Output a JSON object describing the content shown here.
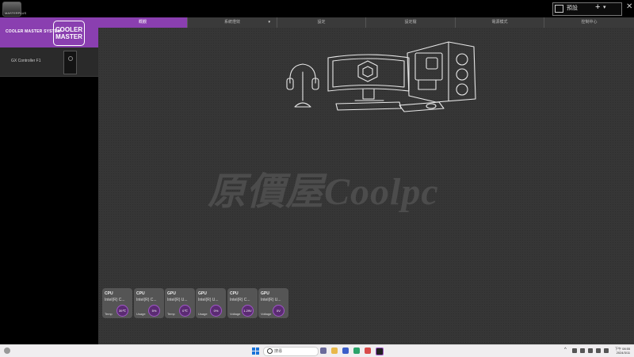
{
  "window": {
    "profile_label": "預設",
    "add_symbol": "+",
    "caret": "▾",
    "close_symbol": "✕",
    "app_logo_text": "MASTERPLUS"
  },
  "sidebar": {
    "brand_text": "COOLER MASTER SYSTEM",
    "brand_logo_line1": "COOLER",
    "brand_logo_line2": "MASTER",
    "brand_color": "#8a3fb0",
    "device": {
      "name": "GX Controller F1"
    }
  },
  "tabs": [
    {
      "label": "概觀",
      "active": true
    },
    {
      "label": "系統燈效",
      "active": false,
      "has_dropdown": true
    },
    {
      "label": "設定",
      "active": false
    },
    {
      "label": "設定檔",
      "active": false
    },
    {
      "label": "電源模式",
      "active": false
    },
    {
      "label": "控制中心",
      "active": false
    }
  ],
  "main": {
    "watermark_text": "原價屋Coolpc",
    "background_color": "#363636"
  },
  "cards": [
    {
      "title": "CPU",
      "sub": "Intel(R) C...",
      "label": "Temp",
      "value": "39℃"
    },
    {
      "title": "CPU",
      "sub": "Intel(R) C...",
      "label": "Usage",
      "value": "5%"
    },
    {
      "title": "GPU",
      "sub": "Intel(R) U...",
      "label": "Temp",
      "value": "0℃"
    },
    {
      "title": "GPU",
      "sub": "Intel(R) U...",
      "label": "Usage",
      "value": "0%"
    },
    {
      "title": "CPU",
      "sub": "Intel(R) C...",
      "label": "Voltage",
      "value": "1.29V"
    },
    {
      "title": "GPU",
      "sub": "Intel(R) U...",
      "label": "Voltage",
      "value": "0V"
    }
  ],
  "taskbar": {
    "search_placeholder": "搜尋",
    "tray_arrow": "^",
    "time": "下午 08:55",
    "date": "2024/3/11"
  }
}
